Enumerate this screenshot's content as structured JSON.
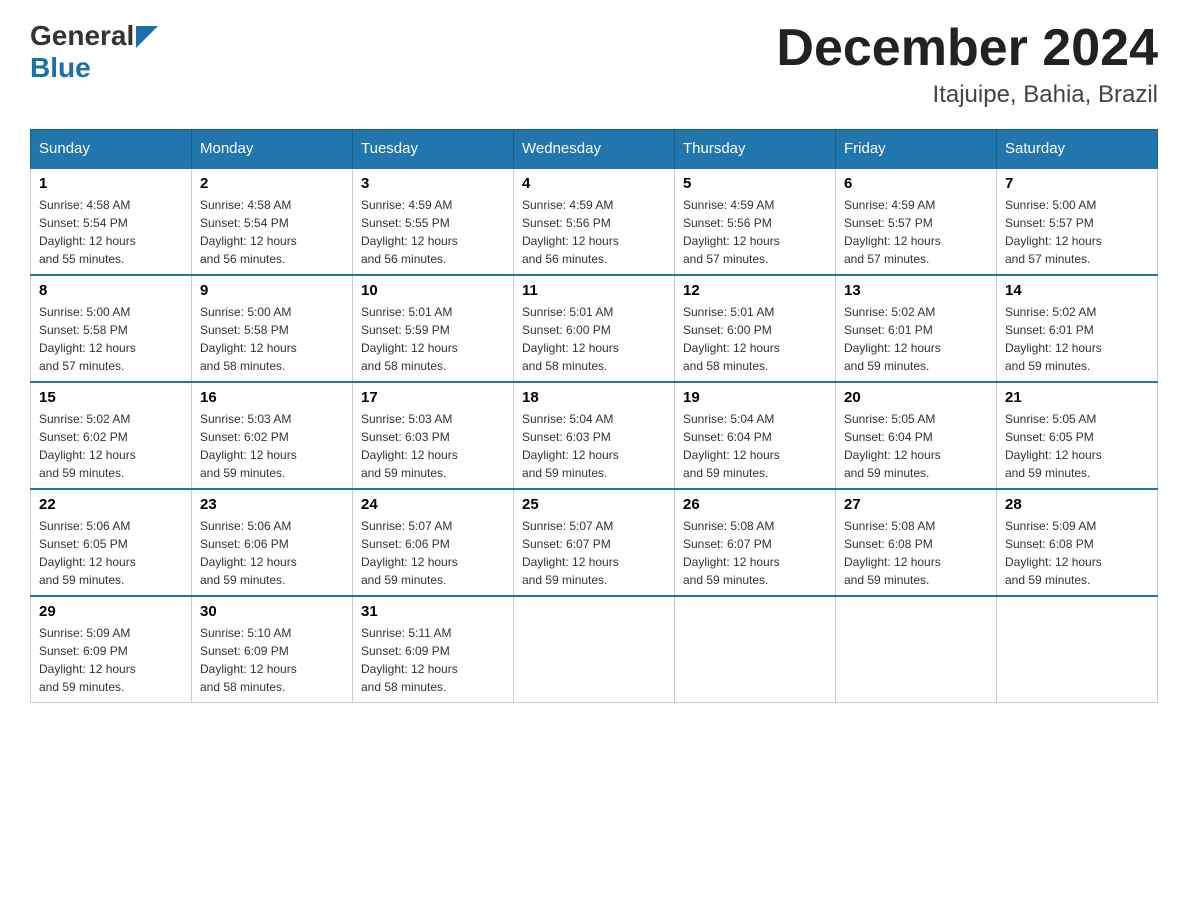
{
  "header": {
    "logo_general": "General",
    "logo_blue": "Blue",
    "month": "December 2024",
    "location": "Itajuipe, Bahia, Brazil"
  },
  "days_of_week": [
    "Sunday",
    "Monday",
    "Tuesday",
    "Wednesday",
    "Thursday",
    "Friday",
    "Saturday"
  ],
  "weeks": [
    [
      {
        "day": "1",
        "sunrise": "4:58 AM",
        "sunset": "5:54 PM",
        "daylight": "12 hours and 55 minutes."
      },
      {
        "day": "2",
        "sunrise": "4:58 AM",
        "sunset": "5:54 PM",
        "daylight": "12 hours and 56 minutes."
      },
      {
        "day": "3",
        "sunrise": "4:59 AM",
        "sunset": "5:55 PM",
        "daylight": "12 hours and 56 minutes."
      },
      {
        "day": "4",
        "sunrise": "4:59 AM",
        "sunset": "5:56 PM",
        "daylight": "12 hours and 56 minutes."
      },
      {
        "day": "5",
        "sunrise": "4:59 AM",
        "sunset": "5:56 PM",
        "daylight": "12 hours and 57 minutes."
      },
      {
        "day": "6",
        "sunrise": "4:59 AM",
        "sunset": "5:57 PM",
        "daylight": "12 hours and 57 minutes."
      },
      {
        "day": "7",
        "sunrise": "5:00 AM",
        "sunset": "5:57 PM",
        "daylight": "12 hours and 57 minutes."
      }
    ],
    [
      {
        "day": "8",
        "sunrise": "5:00 AM",
        "sunset": "5:58 PM",
        "daylight": "12 hours and 57 minutes."
      },
      {
        "day": "9",
        "sunrise": "5:00 AM",
        "sunset": "5:58 PM",
        "daylight": "12 hours and 58 minutes."
      },
      {
        "day": "10",
        "sunrise": "5:01 AM",
        "sunset": "5:59 PM",
        "daylight": "12 hours and 58 minutes."
      },
      {
        "day": "11",
        "sunrise": "5:01 AM",
        "sunset": "6:00 PM",
        "daylight": "12 hours and 58 minutes."
      },
      {
        "day": "12",
        "sunrise": "5:01 AM",
        "sunset": "6:00 PM",
        "daylight": "12 hours and 58 minutes."
      },
      {
        "day": "13",
        "sunrise": "5:02 AM",
        "sunset": "6:01 PM",
        "daylight": "12 hours and 59 minutes."
      },
      {
        "day": "14",
        "sunrise": "5:02 AM",
        "sunset": "6:01 PM",
        "daylight": "12 hours and 59 minutes."
      }
    ],
    [
      {
        "day": "15",
        "sunrise": "5:02 AM",
        "sunset": "6:02 PM",
        "daylight": "12 hours and 59 minutes."
      },
      {
        "day": "16",
        "sunrise": "5:03 AM",
        "sunset": "6:02 PM",
        "daylight": "12 hours and 59 minutes."
      },
      {
        "day": "17",
        "sunrise": "5:03 AM",
        "sunset": "6:03 PM",
        "daylight": "12 hours and 59 minutes."
      },
      {
        "day": "18",
        "sunrise": "5:04 AM",
        "sunset": "6:03 PM",
        "daylight": "12 hours and 59 minutes."
      },
      {
        "day": "19",
        "sunrise": "5:04 AM",
        "sunset": "6:04 PM",
        "daylight": "12 hours and 59 minutes."
      },
      {
        "day": "20",
        "sunrise": "5:05 AM",
        "sunset": "6:04 PM",
        "daylight": "12 hours and 59 minutes."
      },
      {
        "day": "21",
        "sunrise": "5:05 AM",
        "sunset": "6:05 PM",
        "daylight": "12 hours and 59 minutes."
      }
    ],
    [
      {
        "day": "22",
        "sunrise": "5:06 AM",
        "sunset": "6:05 PM",
        "daylight": "12 hours and 59 minutes."
      },
      {
        "day": "23",
        "sunrise": "5:06 AM",
        "sunset": "6:06 PM",
        "daylight": "12 hours and 59 minutes."
      },
      {
        "day": "24",
        "sunrise": "5:07 AM",
        "sunset": "6:06 PM",
        "daylight": "12 hours and 59 minutes."
      },
      {
        "day": "25",
        "sunrise": "5:07 AM",
        "sunset": "6:07 PM",
        "daylight": "12 hours and 59 minutes."
      },
      {
        "day": "26",
        "sunrise": "5:08 AM",
        "sunset": "6:07 PM",
        "daylight": "12 hours and 59 minutes."
      },
      {
        "day": "27",
        "sunrise": "5:08 AM",
        "sunset": "6:08 PM",
        "daylight": "12 hours and 59 minutes."
      },
      {
        "day": "28",
        "sunrise": "5:09 AM",
        "sunset": "6:08 PM",
        "daylight": "12 hours and 59 minutes."
      }
    ],
    [
      {
        "day": "29",
        "sunrise": "5:09 AM",
        "sunset": "6:09 PM",
        "daylight": "12 hours and 59 minutes."
      },
      {
        "day": "30",
        "sunrise": "5:10 AM",
        "sunset": "6:09 PM",
        "daylight": "12 hours and 58 minutes."
      },
      {
        "day": "31",
        "sunrise": "5:11 AM",
        "sunset": "6:09 PM",
        "daylight": "12 hours and 58 minutes."
      },
      null,
      null,
      null,
      null
    ]
  ],
  "labels": {
    "sunrise_prefix": "Sunrise: ",
    "sunset_prefix": "Sunset: ",
    "daylight_prefix": "Daylight: "
  }
}
